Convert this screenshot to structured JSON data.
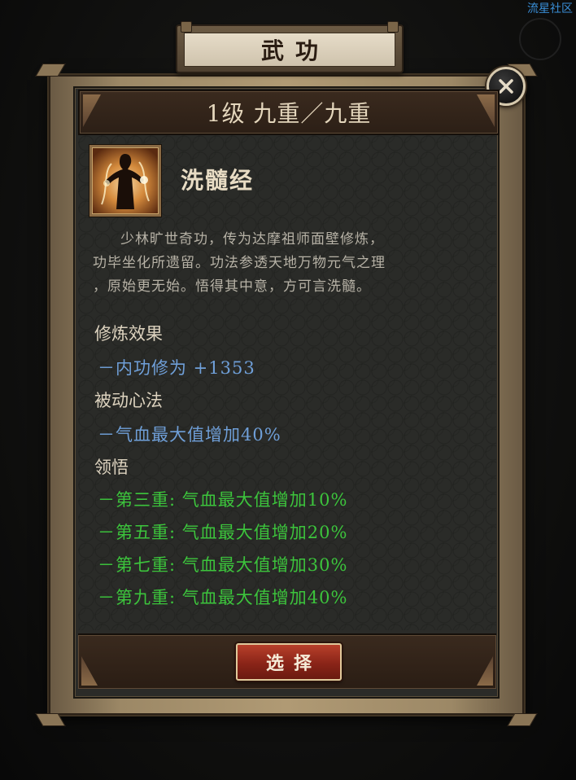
{
  "watermark": "流星社区",
  "header": {
    "title": "武功"
  },
  "close": {
    "icon": "close-icon"
  },
  "level": {
    "text": "1级 九重／九重"
  },
  "skill": {
    "icon": "silhouette-figure-icon",
    "name": "洗髓经",
    "description": [
      "少林旷世奇功，传为达摩祖师面壁修炼，",
      "功毕坐化所遗留。功法参透天地万物元气之理",
      "，原始更无始。悟得其中意，方可言洗髓。"
    ]
  },
  "effects": {
    "title": "修炼效果",
    "items": [
      "－内功修为 +1353"
    ]
  },
  "passive": {
    "title": "被动心法",
    "items": [
      "－气血最大值增加40%"
    ]
  },
  "insight": {
    "title": "领悟",
    "items": [
      "－第三重: 气血最大值增加10%",
      "－第五重: 气血最大值增加20%",
      "－第七重: 气血最大值增加30%",
      "－第九重: 气血最大值增加40%"
    ]
  },
  "footer": {
    "select_label": "选择"
  },
  "colors": {
    "blue_text": "#6f9fd8",
    "green_text": "#3cc43c",
    "button_red": "#8a2418"
  }
}
